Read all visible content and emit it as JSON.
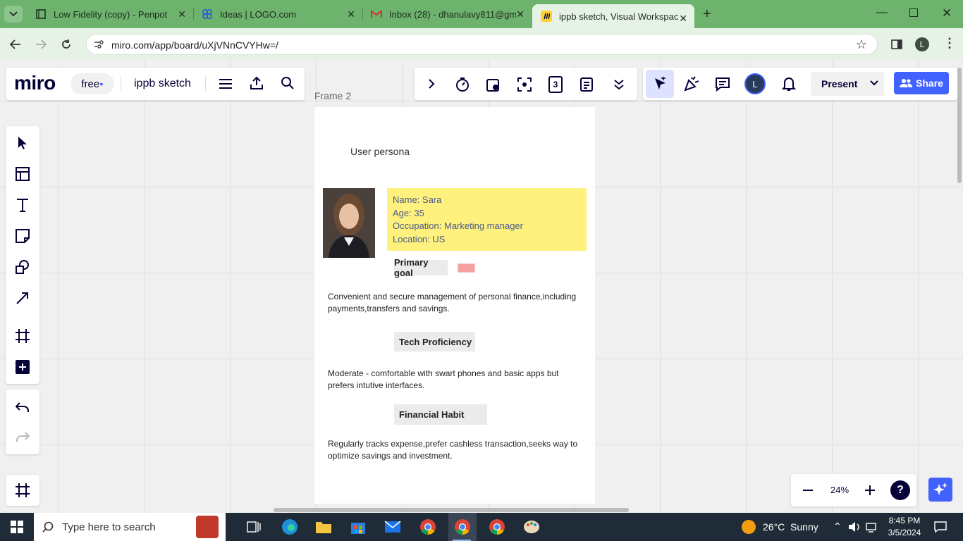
{
  "browser": {
    "tabs": [
      {
        "title": "Low Fidelity (copy) - Penpot"
      },
      {
        "title": "Ideas | LOGO.com"
      },
      {
        "title": "Inbox (28) - dhanulavy811@gm"
      },
      {
        "title": "ippb sketch, Visual Workspace f"
      }
    ],
    "url": "miro.com/app/board/uXjVNnCVYHw=/",
    "profile_initial": "L"
  },
  "miro": {
    "logo": "miro",
    "plan_badge": "free",
    "board_name": "ippb sketch",
    "toolbar_counter": "3",
    "avatar_initial": "L",
    "present_label": "Present",
    "share_label": "Share",
    "zoom": "24%",
    "help": "?",
    "frame_label": "Frame 2"
  },
  "persona": {
    "title": "User persona",
    "info": [
      "Name: Sara",
      "Age: 35",
      "Occupation: Marketing manager",
      "Location: US"
    ],
    "sections": [
      {
        "heading": "Primary goal",
        "text": "Convenient and secure management of personal finance,including payments,transfers and savings."
      },
      {
        "heading": "Tech Proficiency",
        "text": "Moderate - comfortable with swart phones and basic apps but prefers intutive interfaces."
      },
      {
        "heading": "Financial Habit",
        "text": "Regularly tracks expense,prefer cashless transaction,seeks way to optimize savings and investment."
      }
    ]
  },
  "taskbar": {
    "search_placeholder": "Type here to search",
    "weather": "26°C  Sunny",
    "time": "8:45 PM",
    "date": "3/5/2024"
  },
  "colors": {
    "chrome_green": "#6db36d",
    "miro_blue": "#4262ff",
    "sticky_yellow": "#fef17d",
    "text_blue": "#4a5a8c"
  }
}
